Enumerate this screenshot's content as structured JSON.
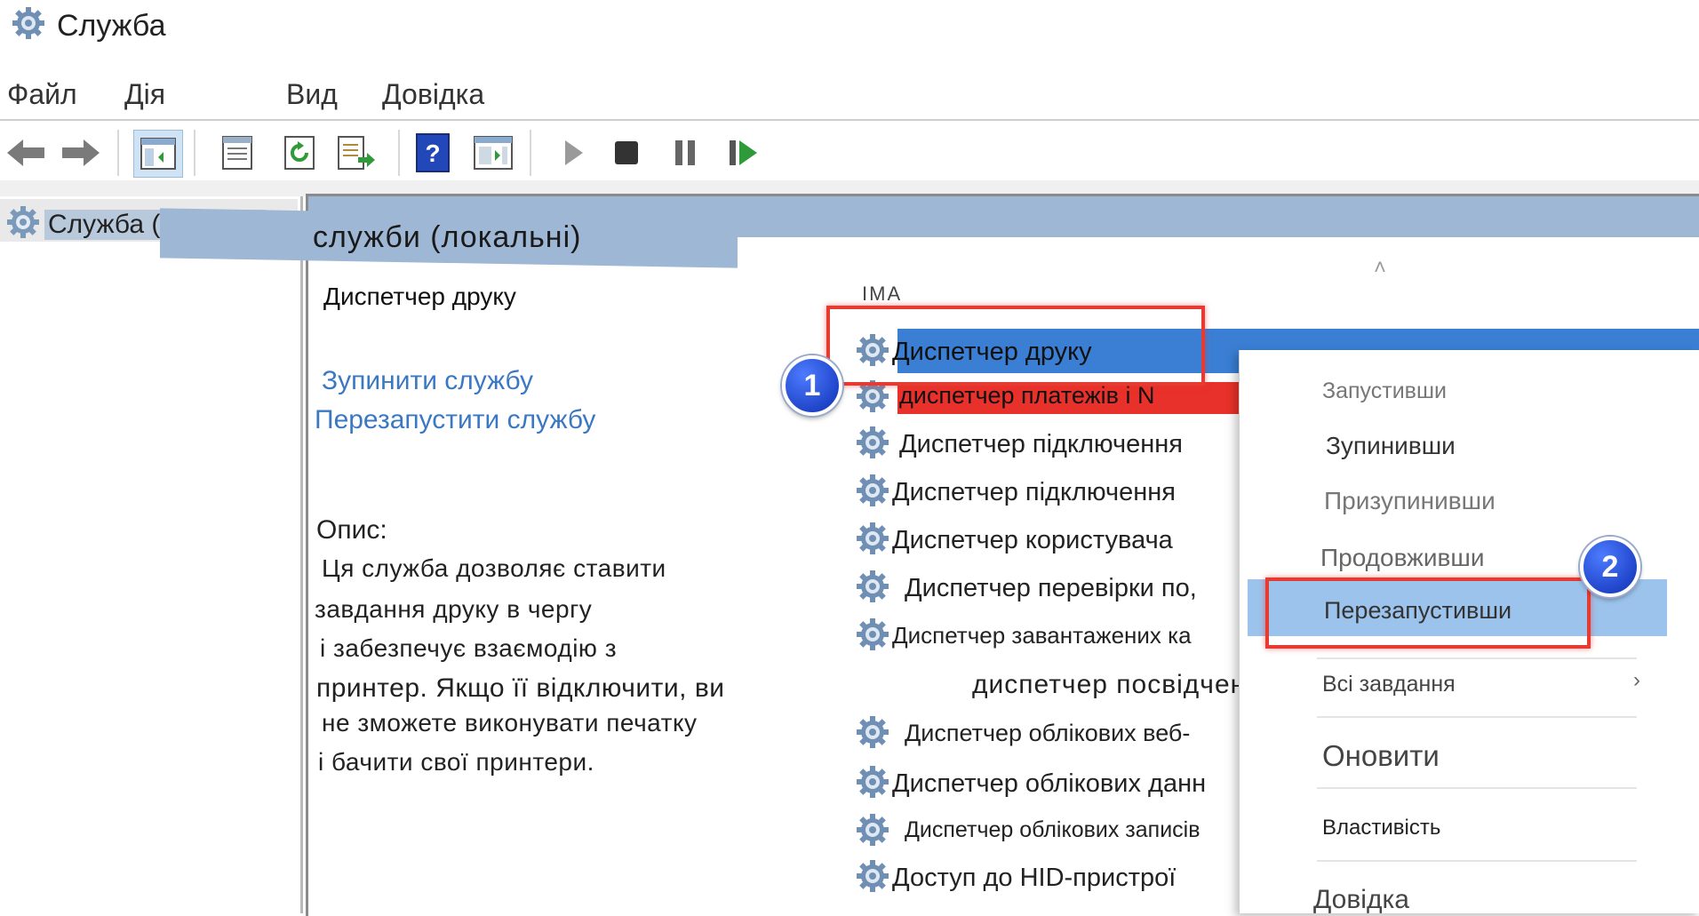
{
  "window": {
    "title": "Служба"
  },
  "menu": {
    "items": [
      "Файл",
      "Дія",
      "Вид",
      "Довідка"
    ]
  },
  "toolbar": {
    "icons": [
      "back-arrow-icon",
      "forward-arrow-icon",
      "console-tree-icon",
      "properties-icon",
      "refresh-icon",
      "export-list-icon",
      "help-icon",
      "show-hide-pane-icon",
      "start-icon",
      "stop-icon",
      "pause-icon",
      "resume-icon"
    ]
  },
  "tree": {
    "root_label": "Служба (локальн"
  },
  "main": {
    "header_title": "служби (локальні)",
    "column_name": "IMA"
  },
  "details": {
    "service_name": "Диспетчер друку",
    "stop_link": "Зупинити службу",
    "restart_link": "Перезапустити службу",
    "description_heading": "Опис:",
    "description_lines": [
      "Ця служба дозволяє ставити",
      "завдання друку в чергу",
      "і забезпечує взаємодію з",
      "принтер. Якщо її відключити, ви",
      "не зможете виконувати печатку",
      "і бачити свої принтери."
    ]
  },
  "services": [
    "Диспетчер друку",
    "диспетчер платежів і N",
    "Диспетчер підключення",
    "Диспетчер підключення",
    "Диспетчер користувача",
    "Диспетчер перевірки по,",
    "Диспетчер завантажених ка",
    "диспетчер     посвідчений.",
    "Диспетчер облікових веб-",
    "Диспетчер облікових данн",
    "Диспетчер облікових записів",
    "Доступ до HID-пристрої"
  ],
  "context_menu": {
    "items": [
      "Запустивши",
      "Зупинивши",
      "Призупинивши",
      "Продовживши",
      "Перезапустивши",
      "Всі завдання",
      "Оновити",
      "Властивість",
      "Довідка"
    ]
  },
  "callouts": [
    "1",
    "2"
  ],
  "colors": {
    "selection": "#3a7fd4",
    "highlight_red": "#e8312a",
    "callout_border": "#e53b32",
    "badge": "#1a3fd0",
    "link": "#3b78c4",
    "header": "#9db7d4",
    "menu_hover": "#9cc3ec"
  }
}
